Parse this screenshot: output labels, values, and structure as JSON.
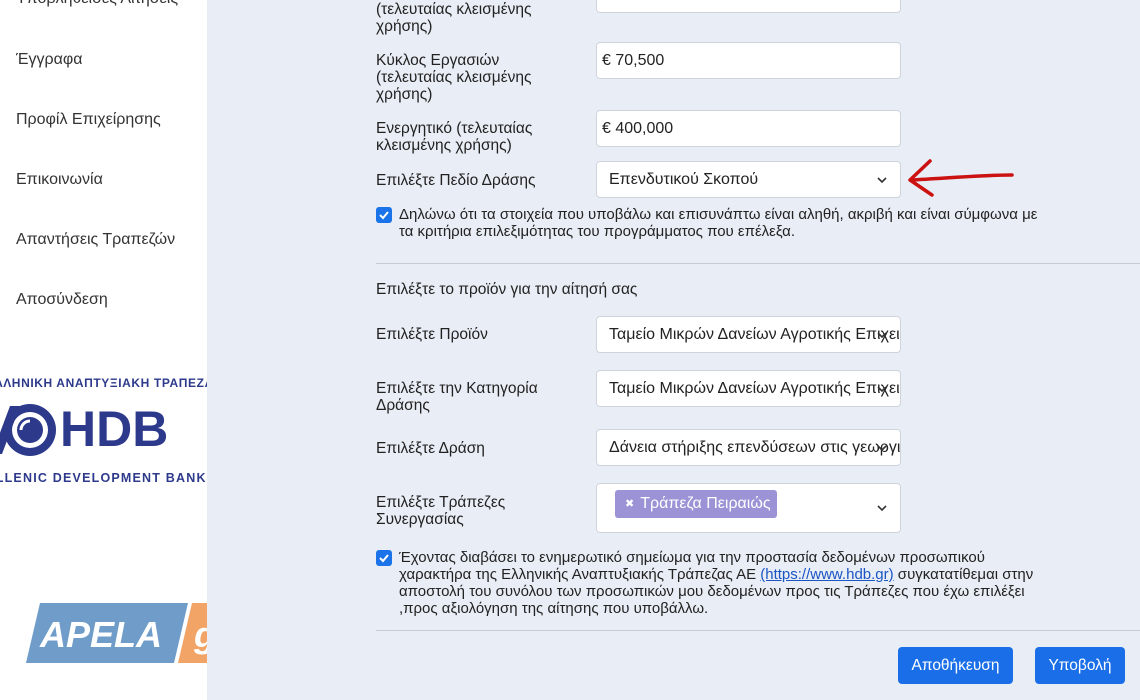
{
  "sidebar": {
    "items": [
      {
        "label": "Υποβληθείσες Αιτήσεις"
      },
      {
        "label": "Έγγραφα"
      },
      {
        "label": "Προφίλ Επιχείρησης"
      },
      {
        "label": "Επικοινωνία"
      },
      {
        "label": "Απαντήσεις Τραπεζών"
      },
      {
        "label": "Αποσύνδεση"
      }
    ],
    "bank_logo": {
      "top_text": "ΕΛΛΗΝΙΚΗ ΑΝΑΠΤΥΞΙΑΚΗ ΤΡΑΠΕΖΑ",
      "name": "HDB",
      "bottom_text": "HELLENIC DEVELOPMENT BANK"
    },
    "apela_logo": {
      "text": "APELA",
      "suffix": "gr"
    }
  },
  "form": {
    "partial_label": "(τελευταίας κλεισμένης χρήσης)",
    "turnover": {
      "label": "Κύκλος Εργασιών (τελευταίας κλεισμένης χρήσης)",
      "value": "€ 70,500"
    },
    "assets": {
      "label": "Ενεργητικό (τελευταίας κλεισμένης χρήσης)",
      "value": "€ 400,000"
    },
    "field_of_action": {
      "label": "Επιλέξτε Πεδίο Δράσης",
      "value": "Επενδυτικού Σκοπού"
    },
    "declaration": {
      "checked": true,
      "text": "Δηλώνω ότι τα στοιχεία που υποβάλω και επισυνάπτω είναι αληθή, ακριβή και είναι σύμφωνα με τα κριτήρια επιλεξιμότητας του προγράμματος που επέλεξα."
    },
    "product_section_title": "Επιλέξτε το προϊόν για την αίτησή σας",
    "product": {
      "label": "Επιλέξτε Προϊόν",
      "value": "Ταμείο Μικρών Δανείων Αγροτικής Επιχειρηματικότητας"
    },
    "action_category": {
      "label": "Επιλέξτε την Κατηγορία Δράσης",
      "value": "Ταμείο Μικρών Δανείων Αγροτικής Επιχειρηματικότητας"
    },
    "action": {
      "label": "Επιλέξτε Δράση",
      "value": "Δάνεια στήριξης επενδύσεων στις γεωργικές εκμεταλλεύσεις"
    },
    "partner_banks": {
      "label": "Επιλέξτε Τράπεζες Συνεργασίας",
      "tags": [
        "Τράπεζα Πειραιώς"
      ]
    },
    "consent": {
      "checked": true,
      "text_before": "Έχοντας διαβάσει το ενημερωτικό σημείωμα για την προστασία δεδομένων προσωπικού χαρακτήρα της Ελληνικής Αναπτυξιακής Τράπεζας ΑΕ ",
      "link_text": "(https://www.hdb.gr)",
      "text_after": " συγκατατίθεμαι στην αποστολή του συνόλου των προσωπικών μου δεδομένων προς τις Τράπεζες που έχω επιλέξει ,προς αξιολόγηση της αίτησης που υποβάλλω."
    }
  },
  "buttons": {
    "save": "Αποθήκευση",
    "submit": "Υποβολή"
  },
  "colors": {
    "primary": "#1a6fe8",
    "tag": "#9b93d6",
    "arrow": "#cc1111",
    "brand": "#2d3a8c"
  }
}
